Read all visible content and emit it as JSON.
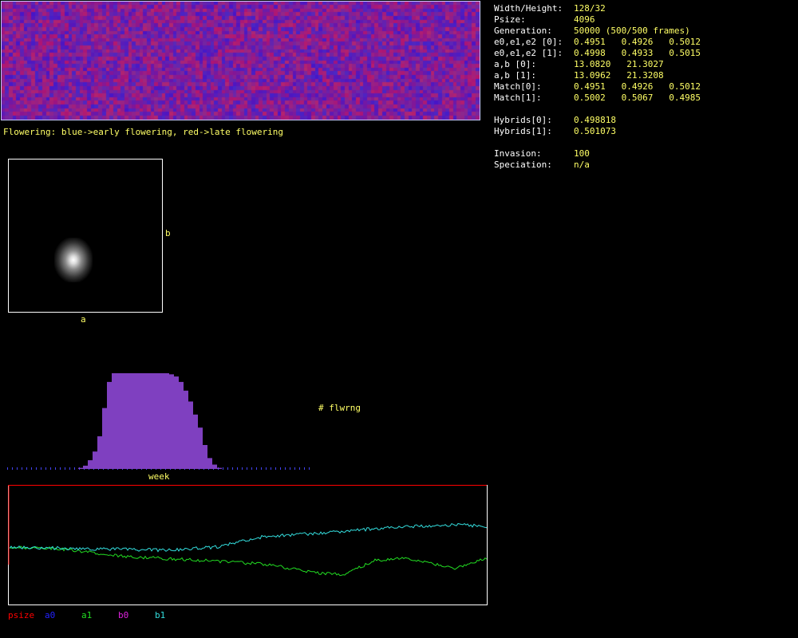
{
  "colors": {
    "psize": "#ff0000",
    "a0": "#2222ff",
    "a1": "#22dd22",
    "b0": "#dd22dd",
    "b1": "#33dddd",
    "hist_fill": "#7f40c0"
  },
  "flowering_caption": "Flowering: blue->early flowering, red->late flowering",
  "stats": [
    {
      "label": "Width/Height:",
      "value": "128/32"
    },
    {
      "label": "Psize:",
      "value": "4096"
    },
    {
      "label": "Generation:",
      "value": "50000 (500/500 frames)"
    },
    {
      "label": "e0,e1,e2 [0]:",
      "value": "0.4951   0.4926   0.5012"
    },
    {
      "label": "e0,e1,e2 [1]:",
      "value": "0.4998   0.4933   0.5015"
    },
    {
      "label": "a,b [0]:",
      "value": "13.0820   21.3027"
    },
    {
      "label": "a,b [1]:",
      "value": "13.0962   21.3208"
    },
    {
      "label": "Match[0]:",
      "value": "0.4951   0.4926   0.5012"
    },
    {
      "label": "Match[1]:",
      "value": "0.5002   0.5067   0.4985"
    },
    {
      "label": "",
      "value": ""
    },
    {
      "label": "Hybrids[0]:",
      "value": "0.498818"
    },
    {
      "label": "Hybrids[1]:",
      "value": "0.501073"
    },
    {
      "label": "",
      "value": ""
    },
    {
      "label": "Invasion:",
      "value": "100"
    },
    {
      "label": "Speciation:",
      "value": "n/a"
    }
  ],
  "ab_plot": {
    "xlabel": "a",
    "ylabel": "b"
  },
  "histogram": {
    "xlabel": "week",
    "ylabel": "# flwrng",
    "values": [
      0,
      0,
      0,
      0,
      0,
      0,
      0,
      0,
      0,
      0,
      0,
      0,
      0,
      0,
      0,
      1,
      3,
      8,
      16,
      30,
      56,
      80,
      88,
      88,
      88,
      88,
      88,
      88,
      88,
      88,
      88,
      88,
      88,
      88,
      87,
      85,
      80,
      72,
      62,
      50,
      38,
      22,
      10,
      4,
      1,
      0,
      0,
      0,
      0,
      0,
      0,
      0,
      0,
      0,
      0,
      0,
      0,
      0,
      0,
      0,
      0,
      0,
      0,
      0
    ]
  },
  "timeplot": {
    "legend": [
      "psize",
      "a0",
      "a1",
      "b0",
      "b1"
    ]
  }
}
